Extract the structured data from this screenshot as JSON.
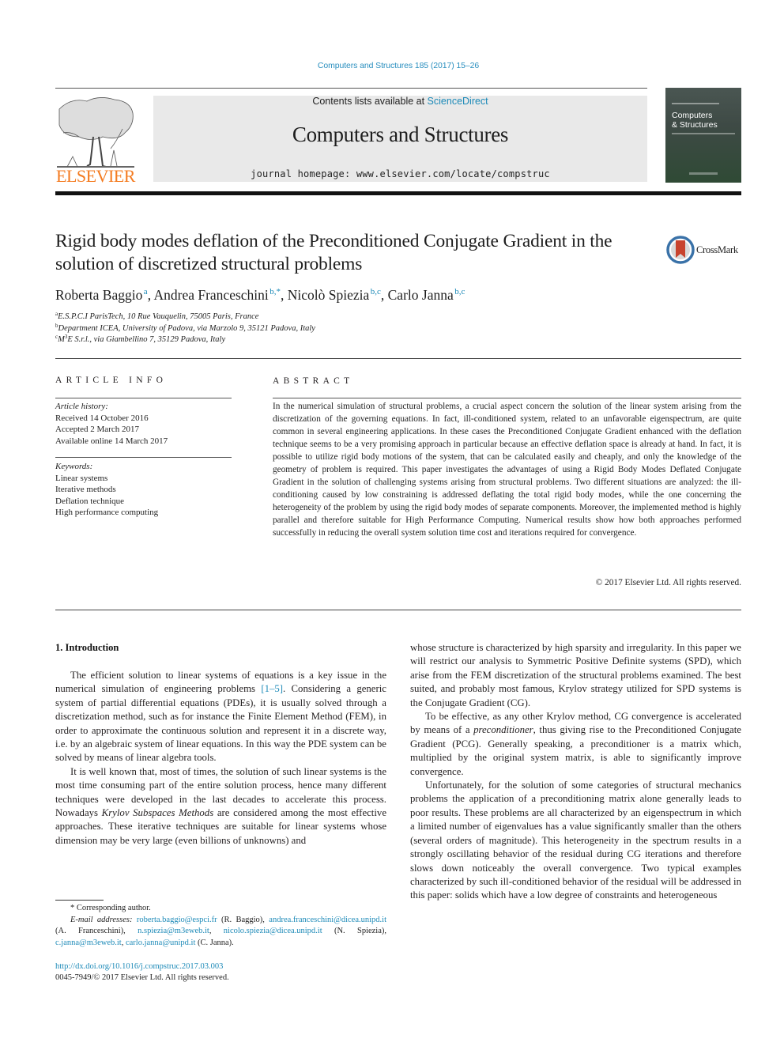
{
  "header": {
    "journal_ref": "Computers and Structures 185 (2017) 15–26",
    "contents_prefix": "Contents lists available at ",
    "contents_link": "ScienceDirect",
    "journal_name": "Computers and Structures",
    "homepage": "journal homepage: www.elsevier.com/locate/compstruc",
    "publisher": "ELSEVIER",
    "cover_title_line1": "Computers",
    "cover_title_line2": "& Structures",
    "crossmark_label": "CrossMark"
  },
  "article": {
    "title": "Rigid body modes deflation of the Preconditioned Conjugate Gradient in the solution of discretized structural problems",
    "authors": [
      {
        "name": "Roberta Baggio",
        "sup": "a"
      },
      {
        "name": "Andrea Franceschini",
        "sup": "b,*"
      },
      {
        "name": "Nicolò Spiezia",
        "sup": "b,c"
      },
      {
        "name": "Carlo Janna",
        "sup": "b,c"
      }
    ],
    "affiliations": [
      {
        "key": "a",
        "text": "E.S.P.C.I ParisTech, 10 Rue Vauquelin, 75005 Paris, France"
      },
      {
        "key": "b",
        "text": "Department ICEA, University of Padova, via Marzolo 9, 35121 Padova, Italy"
      },
      {
        "key": "c",
        "text_pre": "M",
        "text_sup": "3",
        "text_post": "E S.r.l., via Giambellino 7, 35129 Padova, Italy"
      }
    ]
  },
  "article_info": {
    "heading": "ARTICLE INFO",
    "history_label": "Article history:",
    "history": [
      "Received 14 October 2016",
      "Accepted 2 March 2017",
      "Available online 14 March 2017"
    ],
    "keywords_label": "Keywords:",
    "keywords": [
      "Linear systems",
      "Iterative methods",
      "Deflation technique",
      "High performance computing"
    ]
  },
  "abstract": {
    "heading": "ABSTRACT",
    "text": "In the numerical simulation of structural problems, a crucial aspect concern the solution of the linear system arising from the discretization of the governing equations. In fact, ill-conditioned system, related to an unfavorable eigenspectrum, are quite common in several engineering applications. In these cases the Preconditioned Conjugate Gradient enhanced with the deflation technique seems to be a very promising approach in particular because an effective deflation space is already at hand. In fact, it is possible to utilize rigid body motions of the system, that can be calculated easily and cheaply, and only the knowledge of the geometry of problem is required. This paper investigates the advantages of using a Rigid Body Modes Deflated Conjugate Gradient in the solution of challenging systems arising from structural problems. Two different situations are analyzed: the ill-conditioning caused by low constraining is addressed deflating the total rigid body modes, while the one concerning the heterogeneity of the problem by using the rigid body modes of separate components. Moreover, the implemented method is highly parallel and therefore suitable for High Performance Computing. Numerical results show how both approaches performed successfully in reducing the overall system solution time cost and iterations required for convergence.",
    "copyright": "© 2017 Elsevier Ltd. All rights reserved."
  },
  "body": {
    "section_heading": "1. Introduction",
    "left_p1_pre": "The efficient solution to linear systems of equations is a key issue in the numerical simulation of engineering problems ",
    "left_p1_ref": "[1–5]",
    "left_p1_post": ". Considering a generic system of partial differential equations (PDEs), it is usually solved through a discretization method, such as for instance the Finite Element Method (FEM), in order to approximate the continuous solution and represent it in a discrete way, i.e. by an algebraic system of linear equations. In this way the PDE system can be solved by means of linear algebra tools.",
    "left_p2_pre": "It is well known that, most of times, the solution of such linear systems is the most time consuming part of the entire solution process, hence many different techniques were developed in the last decades to accelerate this process. Nowadays ",
    "left_p2_ital": "Krylov Subspaces Methods",
    "left_p2_post": " are considered among the most effective approaches. These iterative techniques are suitable for linear systems whose dimension may be very large (even billions of unknowns) and",
    "right_p1": "whose structure is characterized by high sparsity and irregularity. In this paper we will restrict our analysis to Symmetric Positive Definite systems (SPD), which arise from the FEM discretization of the structural problems examined. The best suited, and probably most famous, Krylov strategy utilized for SPD systems is the Conjugate Gradient (CG).",
    "right_p2_pre": "To be effective, as any other Krylov method, CG convergence is accelerated by means of a ",
    "right_p2_ital": "preconditioner",
    "right_p2_post": ", thus giving rise to the Preconditioned Conjugate Gradient (PCG). Generally speaking, a preconditioner is a matrix which, multiplied by the original system matrix, is able to significantly improve convergence.",
    "right_p3": "Unfortunately, for the solution of some categories of structural mechanics problems the application of a preconditioning matrix alone generally leads to poor results. These problems are all characterized by an eigenspectrum in which a limited number of eigenvalues has a value significantly smaller than the others (several orders of magnitude). This heterogeneity in the spectrum results in a strongly oscillating behavior of the residual during CG iterations and therefore slows down noticeably the overall convergence. Two typical examples characterized by such ill-conditioned behavior of the residual will be addressed in this paper: solids which have a low degree of constraints and heterogeneous"
  },
  "footnotes": {
    "corresponding": "* Corresponding author.",
    "email_label": "E-mail addresses:",
    "emails": [
      {
        "addr": "roberta.baggio@espci.fr",
        "who": " (R. Baggio), "
      },
      {
        "addr": "andrea.franceschini@dicea.unipd.it",
        "who": " (A. Franceschini), "
      },
      {
        "addr": "n.spiezia@m3eweb.it",
        "who": ", "
      },
      {
        "addr": "nicolo.spiezia@dicea.unipd.it",
        "who": " (N. Spiezia), "
      },
      {
        "addr": "c.janna@m3eweb.it",
        "who": ", "
      },
      {
        "addr": "carlo.janna@unipd.it",
        "who": " (C. Janna)."
      }
    ],
    "doi": "http://dx.doi.org/10.1016/j.compstruc.2017.03.003",
    "issn": "0045-7949/© 2017 Elsevier Ltd. All rights reserved."
  },
  "colors": {
    "link": "#1d8ab8",
    "elsevier_orange": "#f47b20",
    "masthead_bg": "#e9e9e9",
    "cover_green": "#2f4a35"
  }
}
